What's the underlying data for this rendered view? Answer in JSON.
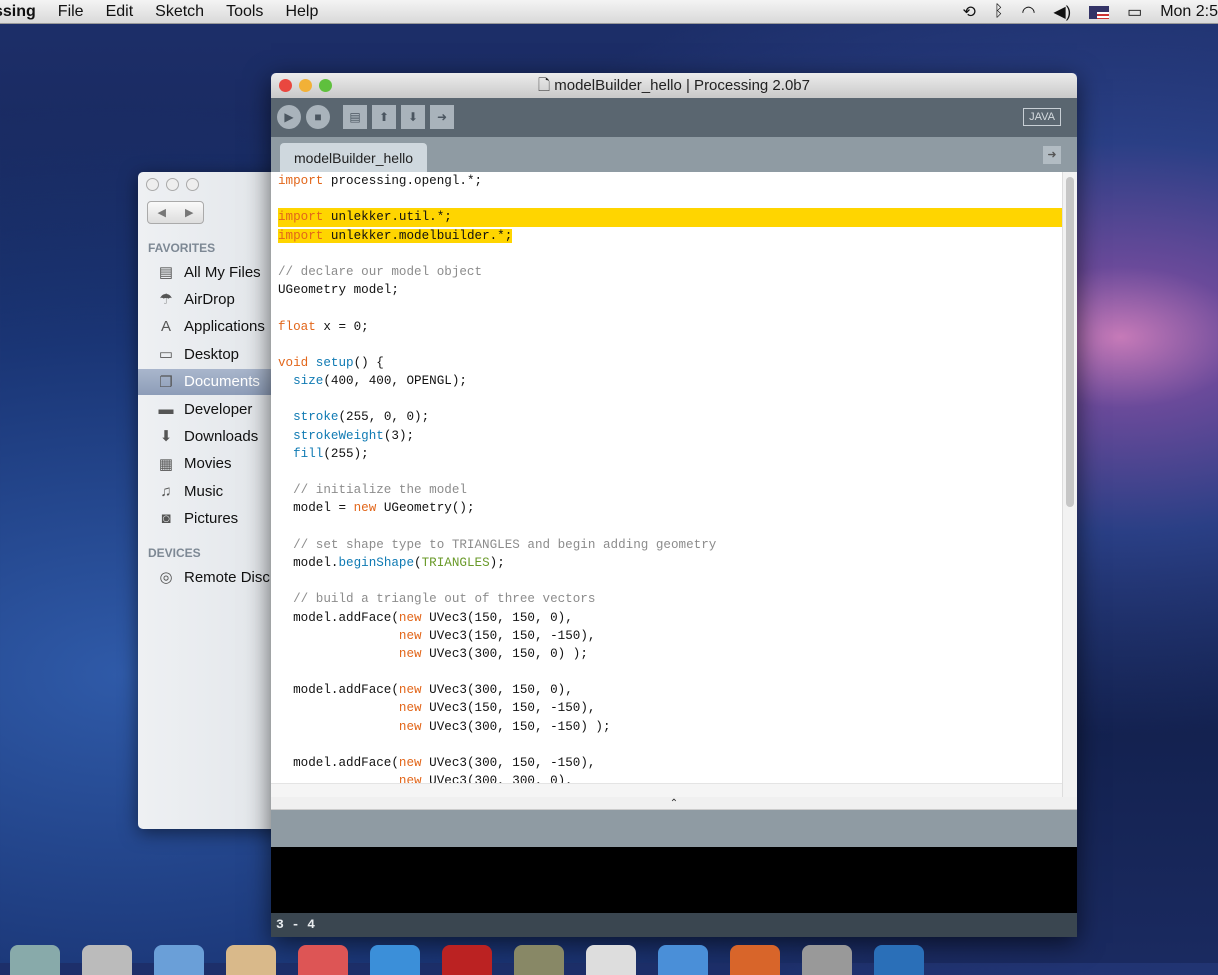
{
  "menubar": {
    "app": "ssing",
    "items": [
      "File",
      "Edit",
      "Sketch",
      "Tools",
      "Help"
    ],
    "clock": "Mon 2:5",
    "status_icons": [
      "time-machine-icon",
      "bluetooth-icon",
      "wifi-icon",
      "volume-icon",
      "us-flag-icon",
      "battery-icon"
    ]
  },
  "finder": {
    "favorites_label": "FAVORITES",
    "devices_label": "DEVICES",
    "favorites": [
      {
        "label": "All My Files",
        "icon": "all-files-icon",
        "glyph": "▤"
      },
      {
        "label": "AirDrop",
        "icon": "airdrop-icon",
        "glyph": "☂"
      },
      {
        "label": "Applications",
        "icon": "applications-icon",
        "glyph": "A"
      },
      {
        "label": "Desktop",
        "icon": "desktop-icon",
        "glyph": "▭"
      },
      {
        "label": "Documents",
        "icon": "documents-icon",
        "glyph": "❐",
        "selected": true
      },
      {
        "label": "Developer",
        "icon": "folder-icon",
        "glyph": "▬"
      },
      {
        "label": "Downloads",
        "icon": "downloads-icon",
        "glyph": "⬇"
      },
      {
        "label": "Movies",
        "icon": "movies-icon",
        "glyph": "▦"
      },
      {
        "label": "Music",
        "icon": "music-icon",
        "glyph": "♫"
      },
      {
        "label": "Pictures",
        "icon": "camera-icon",
        "glyph": "◙"
      }
    ],
    "devices": [
      {
        "label": "Remote Disc",
        "icon": "disc-icon",
        "glyph": "◎"
      }
    ]
  },
  "window": {
    "title": "modelBuilder_hello | Processing 2.0b7",
    "mode": "JAVA",
    "tab": "modelBuilder_hello",
    "status": "3 - 4",
    "colors": {
      "keyword": "#e2661a",
      "function": "#0f7ab3",
      "comment": "#8c8c8c",
      "constant": "#6a9a2a",
      "highlight": "#ffd500"
    }
  },
  "code": [
    [
      [
        "import",
        "k"
      ],
      [
        " processing.opengl.*;",
        ""
      ]
    ],
    [],
    {
      "hl": "full",
      "t": [
        [
          "import",
          "k"
        ],
        [
          " unlekker.util.*;",
          ""
        ]
      ]
    },
    {
      "hl": "text",
      "t": [
        [
          "import",
          "k"
        ],
        [
          " unlekker.modelbuilder.*;",
          ""
        ]
      ]
    },
    [],
    [
      [
        "// declare our model object",
        "c"
      ]
    ],
    [
      [
        "UGeometry model;",
        ""
      ]
    ],
    [],
    [
      [
        "float",
        "k"
      ],
      [
        " x = 0;",
        ""
      ]
    ],
    [],
    [
      [
        "void",
        "k"
      ],
      [
        " ",
        ""
      ],
      [
        "setup",
        "f"
      ],
      [
        "() {",
        ""
      ]
    ],
    [
      [
        "  ",
        ""
      ],
      [
        "size",
        "f"
      ],
      [
        "(400, 400, OPENGL);",
        ""
      ]
    ],
    [],
    [
      [
        "  ",
        ""
      ],
      [
        "stroke",
        "f"
      ],
      [
        "(255, 0, 0);",
        ""
      ]
    ],
    [
      [
        "  ",
        ""
      ],
      [
        "strokeWeight",
        "f"
      ],
      [
        "(3);",
        ""
      ]
    ],
    [
      [
        "  ",
        ""
      ],
      [
        "fill",
        "f"
      ],
      [
        "(255);",
        ""
      ]
    ],
    [],
    [
      [
        "  // initialize the model",
        "c"
      ]
    ],
    [
      [
        "  model = ",
        ""
      ],
      [
        "new",
        "k"
      ],
      [
        " UGeometry();",
        ""
      ]
    ],
    [],
    [
      [
        "  // set shape type to TRIANGLES and begin adding geometry",
        "c"
      ]
    ],
    [
      [
        "  model.",
        ""
      ],
      [
        "beginShape",
        "f"
      ],
      [
        "(",
        ""
      ],
      [
        "TRIANGLES",
        "g"
      ],
      [
        ");",
        ""
      ]
    ],
    [],
    [
      [
        "  // build a triangle out of three vectors",
        "c"
      ]
    ],
    [
      [
        "  model.addFace(",
        ""
      ],
      [
        "new",
        "k"
      ],
      [
        " UVec3(150, 150, 0),",
        ""
      ]
    ],
    [
      [
        "                ",
        ""
      ],
      [
        "new",
        "k"
      ],
      [
        " UVec3(150, 150, -150),",
        ""
      ]
    ],
    [
      [
        "                ",
        ""
      ],
      [
        "new",
        "k"
      ],
      [
        " UVec3(300, 150, 0) );",
        ""
      ]
    ],
    [],
    [
      [
        "  model.addFace(",
        ""
      ],
      [
        "new",
        "k"
      ],
      [
        " UVec3(300, 150, 0),",
        ""
      ]
    ],
    [
      [
        "                ",
        ""
      ],
      [
        "new",
        "k"
      ],
      [
        " UVec3(150, 150, -150),",
        ""
      ]
    ],
    [
      [
        "                ",
        ""
      ],
      [
        "new",
        "k"
      ],
      [
        " UVec3(300, 150, -150) );",
        ""
      ]
    ],
    [],
    [
      [
        "  model.addFace(",
        ""
      ],
      [
        "new",
        "k"
      ],
      [
        " UVec3(300, 150, -150),",
        ""
      ]
    ],
    [
      [
        "                ",
        ""
      ],
      [
        "new",
        "k"
      ],
      [
        " UVec3(300, 300, 0),",
        ""
      ]
    ]
  ]
}
